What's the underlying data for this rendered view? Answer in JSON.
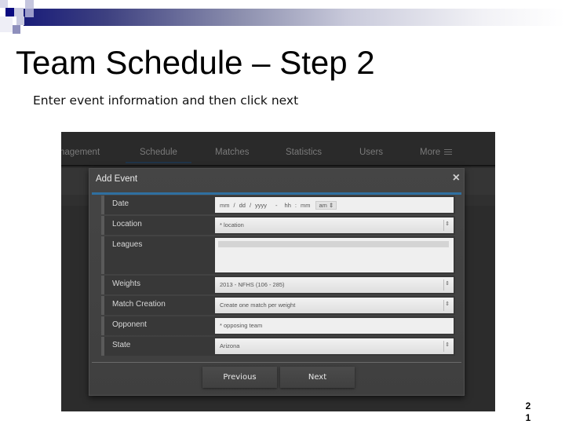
{
  "slide": {
    "title": "Team Schedule – Step 2",
    "subtitle": "Enter event information and then click next",
    "page_number_line1": "2",
    "page_number_line2": "1"
  },
  "nav": {
    "items": [
      {
        "label": "nagement",
        "active": false
      },
      {
        "label": "Schedule",
        "active": true
      },
      {
        "label": "Matches",
        "active": false
      },
      {
        "label": "Statistics",
        "active": false
      },
      {
        "label": "Users",
        "active": false
      },
      {
        "label": "More",
        "active": false,
        "icon": "hamburger-menu-icon"
      }
    ]
  },
  "modal": {
    "title": "Add Event",
    "close_icon": "×",
    "fields": {
      "date": {
        "label": "Date",
        "month_placeholder": "mm",
        "sep1": "/",
        "day_placeholder": "dd",
        "sep2": "/",
        "year_placeholder": "yyyy",
        "dash": "-",
        "hour_placeholder": "hh",
        "colon": ":",
        "minute_placeholder": "mm",
        "ampm_value": "am",
        "stepper": "⇕"
      },
      "location": {
        "label": "Location",
        "value": "* location",
        "stepper": "⇕"
      },
      "leagues": {
        "label": "Leagues"
      },
      "weights": {
        "label": "Weights",
        "value": "2013 - NFHS (106 - 285)",
        "stepper": "⇕"
      },
      "match_creation": {
        "label": "Match Creation",
        "value": "Create one match per weight",
        "stepper": "⇕"
      },
      "opponent": {
        "label": "Opponent",
        "placeholder": "* opposing team"
      },
      "state": {
        "label": "State",
        "value": "Arizona",
        "stepper": "⇕"
      }
    },
    "buttons": {
      "previous": "Previous",
      "next": "Next"
    }
  },
  "colors": {
    "accent_rule": "#2f6fa0",
    "modal_bg": "#434343",
    "app_bg": "#2c2c2c"
  }
}
